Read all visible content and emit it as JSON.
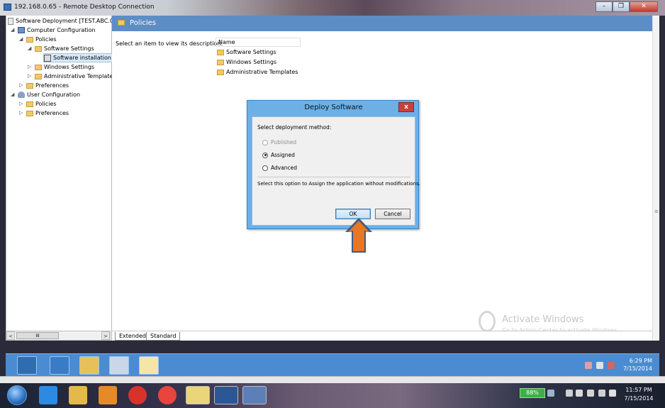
{
  "window": {
    "title": "192.168.0.65 - Remote Desktop Connection",
    "minimize": "–",
    "restore": "❐",
    "close": "✕"
  },
  "tree": {
    "root": "Software Deployment [TEST.ABC.CC",
    "computer_config": "Computer Configuration",
    "policies": "Policies",
    "software_settings": "Software Settings",
    "software_installation": "Software installation",
    "windows_settings": "Windows Settings",
    "admin_templates": "Administrative Templates",
    "preferences": "Preferences",
    "user_config": "User Configuration",
    "user_policies": "Policies",
    "user_preferences": "Preferences"
  },
  "scroll": {
    "left_arrow": "<",
    "right_arrow": ">",
    "thumb": "III"
  },
  "right_pane": {
    "header_title": "Policies",
    "description": "Select an item to view its description.",
    "column_name": "Name",
    "items": [
      "Software Settings",
      "Windows Settings",
      "Administrative Templates"
    ]
  },
  "tabs": {
    "extended": "Extended",
    "standard": "Standard"
  },
  "watermark": {
    "title": "Activate Windows",
    "subtitle": "Go to Action Center to activate Windows."
  },
  "dialog": {
    "title": "Deploy Software",
    "close": "x",
    "prompt": "Select deployment method:",
    "options": [
      {
        "label": "Published",
        "checked": false,
        "enabled": false
      },
      {
        "label": "Assigned",
        "checked": true,
        "enabled": true
      },
      {
        "label": "Advanced",
        "checked": false,
        "enabled": true
      }
    ],
    "description": "Select this option to Assign the application without modifications.",
    "ok": "OK",
    "cancel": "Cancel"
  },
  "remote_clock": {
    "time": "6:29 PM",
    "date": "7/15/2014"
  },
  "local_tray": {
    "battery": "88%",
    "time": "11:57 PM",
    "date": "7/15/2014"
  },
  "colors": {
    "accent_blue": "#5d8dc5",
    "dialog_frame": "#6cb0e6",
    "arrow": "#e87722",
    "remote_taskbar": "#4b8bd1"
  }
}
